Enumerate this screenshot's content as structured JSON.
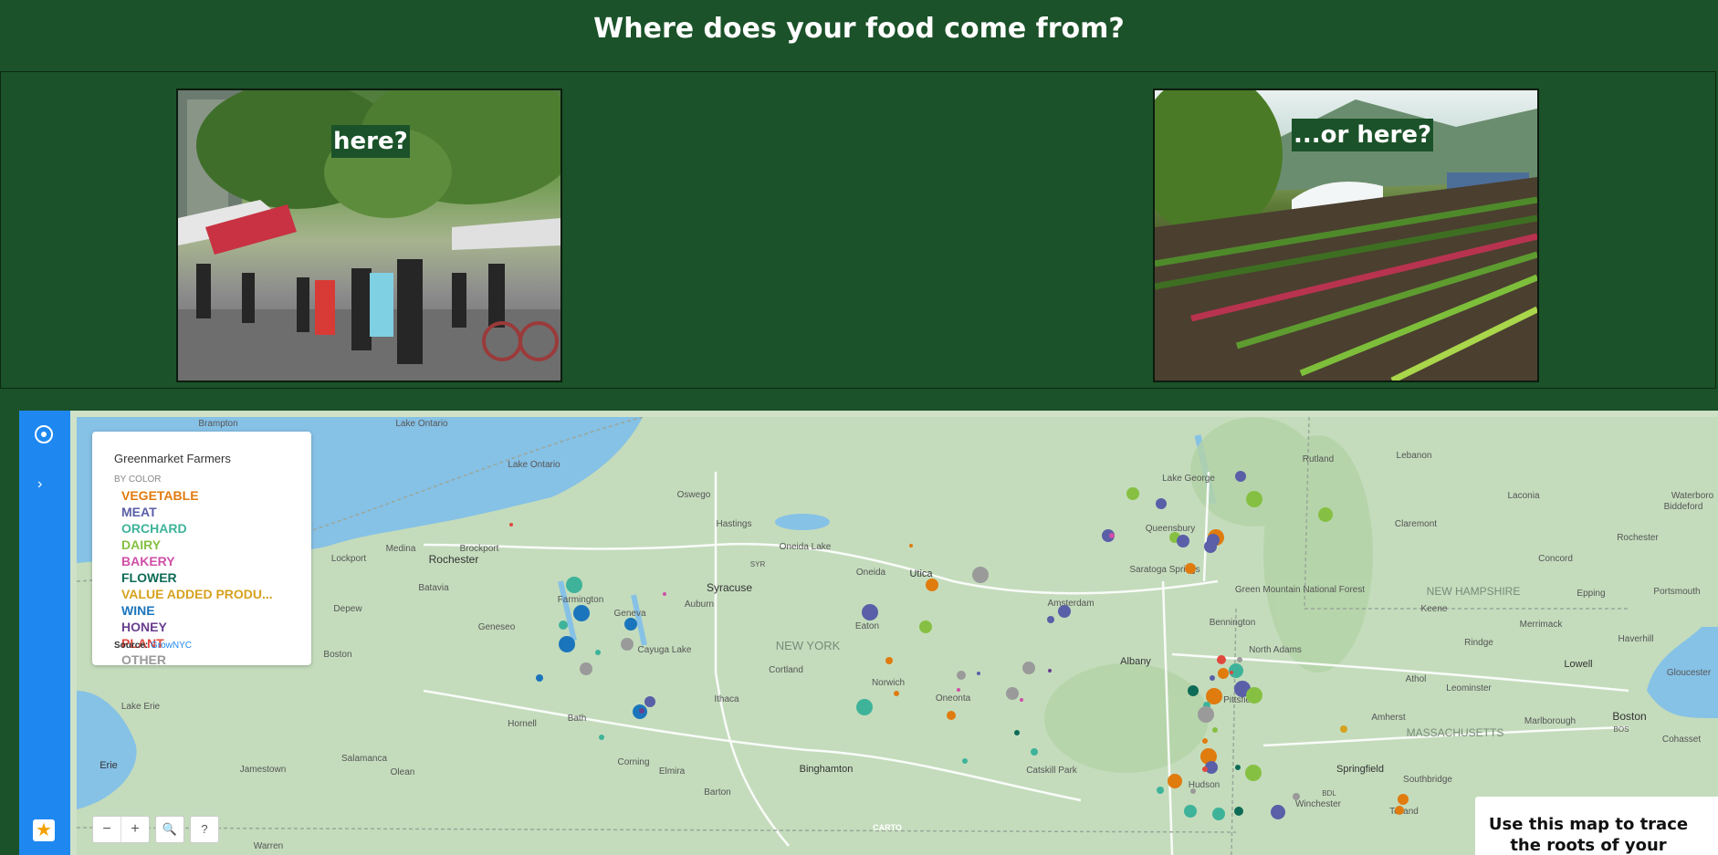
{
  "page": {
    "title": "Where does your food come from?"
  },
  "photos": [
    {
      "caption": "here?"
    },
    {
      "caption": "...or here?"
    }
  ],
  "legend": {
    "title": "Greenmarket Farmers",
    "subtitle": "BY COLOR",
    "categories": [
      {
        "label": "VEGETABLE",
        "color": "#e07b0e"
      },
      {
        "label": "MEAT",
        "color": "#5a5fa8"
      },
      {
        "label": "ORCHARD",
        "color": "#3eb39a"
      },
      {
        "label": "DAIRY",
        "color": "#86c043"
      },
      {
        "label": "BAKERY",
        "color": "#d04fa7"
      },
      {
        "label": "FLOWER",
        "color": "#0e6b57"
      },
      {
        "label": "VALUE ADDED PRODU...",
        "color": "#d6a21e"
      },
      {
        "label": "WINE",
        "color": "#1b75bc"
      },
      {
        "label": "HONEY",
        "color": "#6a3f8f"
      },
      {
        "label": "PLANT",
        "color": "#e0483e"
      },
      {
        "label": "OTHER",
        "color": "#9a9a9a"
      }
    ],
    "source_label": "Source:",
    "source_link": "GrowNYC"
  },
  "map": {
    "labels": {
      "ontario_top": "Lake Ontario",
      "ontario": "Lake Ontario",
      "oswego": "Oswego",
      "hastings": "Hastings",
      "rochester": "Rochester",
      "brockport": "Brockport",
      "medina": "Medina",
      "lockport": "Lockport",
      "batavia": "Batavia",
      "geneseo": "Geneseo",
      "depew": "Depew",
      "farmington": "Farmington",
      "geneva": "Geneva",
      "auburn": "Auburn",
      "syracuse": "Syracuse",
      "oneida_lake": "Oneida Lake",
      "oneida": "Oneida",
      "utica": "Utica",
      "syr": "SYR",
      "newyork": "NEW YORK",
      "cayuga": "Cayuga Lake",
      "ithaca": "Ithaca",
      "cortland": "Cortland",
      "eaton": "Eaton",
      "norwich": "Norwich",
      "oneonta": "Oneonta",
      "amsterdam": "Amsterdam",
      "albany": "Albany",
      "saratoga": "Saratoga Springs",
      "queensbury": "Queensbury",
      "lakegeorge": "Lake George",
      "rutland": "Rutland",
      "lebanon": "Lebanon",
      "laconia": "Laconia",
      "waterboro": "Waterboro",
      "biddeford": "Biddeford",
      "claremont": "Claremont",
      "rochester_nh": "Rochester",
      "concord": "Concord",
      "newhampshire": "NEW HAMPSHIRE",
      "keene": "Keene",
      "epping": "Epping",
      "portsmouth": "Portsmouth",
      "greenmtn": "Green Mountain National Forest",
      "bennington": "Bennington",
      "northadams": "North Adams",
      "merrimack": "Merrimack",
      "haverhill": "Haverhill",
      "rindge": "Rindge",
      "lowell": "Lowell",
      "athol": "Athol",
      "leominster": "Leominster",
      "gloucester": "Gloucester",
      "pittsfield": "Pittsfield",
      "amherst": "Amherst",
      "massachusetts": "MASSACHUSETTS",
      "marlborough": "Marlborough",
      "boston": "Boston",
      "bos": "BOS",
      "cohasset": "Cohasset",
      "springfield": "Springfield",
      "southbridge": "Southbridge",
      "winchester": "Winchester",
      "tolland": "Tolland",
      "bdl": "BDL",
      "hudson": "Hudson",
      "catskill": "Catskill Park",
      "binghamton": "Binghamton",
      "elmira": "Elmira",
      "corning": "Corning",
      "barton": "Barton",
      "hornell": "Hornell",
      "bath": "Bath",
      "salamanca": "Salamanca",
      "olean": "Olean",
      "jamestown": "Jamestown",
      "lakeerie": "Lake Erie",
      "erie": "Erie",
      "warren": "Warren",
      "boston_ny": "Boston",
      "brampton": "Brampton",
      "carto": "CARTO"
    }
  },
  "map_controls": {
    "zoom_out": "−",
    "zoom_in": "+",
    "search": "🔍",
    "help": "?"
  },
  "info_card": {
    "text": "Use this map to trace the roots of your fave"
  }
}
